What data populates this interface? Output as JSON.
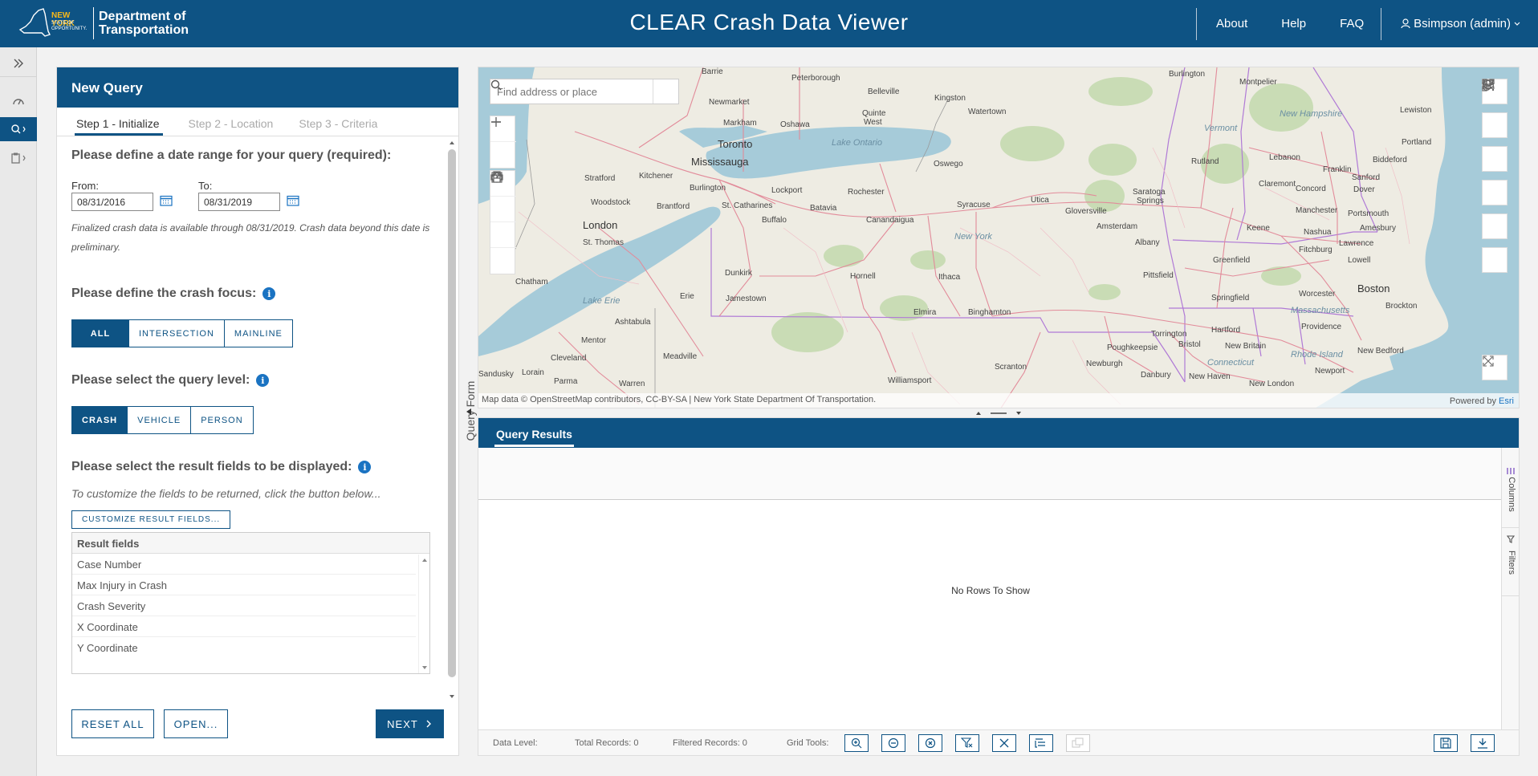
{
  "header": {
    "logo_state": "NEW YORK",
    "logo_tagline": "STATE OF OPPORTUNITY.",
    "logo_dept_line1": "Department of",
    "logo_dept_line2": "Transportation",
    "app_title": "CLEAR Crash Data Viewer",
    "nav": {
      "about": "About",
      "help": "Help",
      "faq": "FAQ",
      "user": "Bsimpson (admin)"
    }
  },
  "rail": {
    "items": [
      "expand-icon",
      "dashboard-icon",
      "search-icon",
      "clipboard-icon"
    ]
  },
  "query": {
    "title": "New Query",
    "steps": [
      "Step 1 - Initialize",
      "Step 2 - Location",
      "Step 3 - Criteria"
    ],
    "date_section": "Please define a date range for your query (required):",
    "from_label": "From:",
    "from_value": "08/31/2016",
    "to_label": "To:",
    "to_value": "08/31/2019",
    "note": "Finalized crash data is available through 08/31/2019. Crash data beyond this date is preliminary.",
    "focus_section": "Please define the crash focus:",
    "focus_options": [
      "ALL",
      "INTERSECTION",
      "MAINLINE"
    ],
    "level_section": "Please select the query level:",
    "level_options": [
      "CRASH",
      "VEHICLE",
      "PERSON"
    ],
    "fields_section": "Please select the result fields to be displayed:",
    "fields_hint": "To customize the fields to be returned, click the button below...",
    "customize_btn": "CUSTOMIZE RESULT FIELDS...",
    "fields_header": "Result fields",
    "fields": [
      "Case Number",
      "Max Injury in Crash",
      "Crash Severity",
      "X Coordinate",
      "Y Coordinate"
    ],
    "reset_btn": "RESET ALL",
    "open_btn": "OPEN...",
    "next_btn": "NEXT",
    "collapse_label": "Query Form"
  },
  "map": {
    "search_placeholder": "Find address or place",
    "attribution": "Map data © OpenStreetMap contributors, CC-BY-SA | New York State Department Of Transportation.",
    "powered_prefix": "Powered by ",
    "powered_brand": "Esri",
    "lakes": {
      "ontario": "Lake Ontario",
      "erie": "Lake Erie"
    },
    "regions": {
      "vermont": "Vermont",
      "nh": "New Hampshire",
      "ny": "New York",
      "mass": "Massachusetts",
      "ri": "Rhode Island",
      "ct": "Connecticut"
    },
    "cities": {
      "barrie": "Barrie",
      "peterborough": "Peterborough",
      "belleville": "Belleville",
      "kingston": "Kingston",
      "burlington_vt": "Burlington",
      "montpelier": "Montpelier",
      "lewiston": "Lewiston",
      "newmarket": "Newmarket",
      "markham": "Markham",
      "oshawa": "Oshawa",
      "quinte": "Quinte",
      "west": "West",
      "watertown": "Watertown",
      "portland": "Portland",
      "toronto": "Toronto",
      "mississauga": "Mississauga",
      "stratford": "Stratford",
      "kitchener": "Kitchener",
      "burlington_on": "Burlington",
      "oswego": "Oswego",
      "rutland": "Rutland",
      "lebanon": "Lebanon",
      "biddeford": "Biddeford",
      "franklin": "Franklin",
      "claremont": "Claremont",
      "sanford": "Sanford",
      "saratoga": "Saratoga",
      "springs": "Springs",
      "concord": "Concord",
      "dover": "Dover",
      "lockport": "Lockport",
      "rochester": "Rochester",
      "woodstock": "Woodstock",
      "brantford": "Brantford",
      "stcath": "St. Catharines",
      "batavia": "Batavia",
      "syracuse": "Syracuse",
      "utica": "Utica",
      "gloversville": "Gloversville",
      "manchester": "Manchester",
      "portsmouth": "Portsmouth",
      "london": "London",
      "buffalo": "Buffalo",
      "canandaigua": "Canandaigua",
      "amsterdam": "Amsterdam",
      "nashua": "Nashua",
      "amesbury": "Amesbury",
      "stthomas": "St. Thomas",
      "albany": "Albany",
      "keene": "Keene",
      "lawrence": "Lawrence",
      "fitchburg": "Fitchburg",
      "greenfield": "Greenfield",
      "lowell": "Lowell",
      "chatham": "Chatham",
      "dunkirk": "Dunkirk",
      "hornell": "Hornell",
      "ithaca": "Ithaca",
      "pittsfield": "Pittsfield",
      "boston": "Boston",
      "erie": "Erie",
      "jamestown": "Jamestown",
      "springfield": "Springfield",
      "worcester": "Worcester",
      "elmira": "Elmira",
      "binghamton": "Binghamton",
      "brockton": "Brockton",
      "ashtabula": "Ashtabula",
      "torrington": "Torrington",
      "hartford": "Hartford",
      "providence": "Providence",
      "mentor": "Mentor",
      "bristol": "Bristol",
      "newbritain": "New Britain",
      "poughkeepsie": "Poughkeepsie",
      "meadville": "Meadville",
      "cleveland": "Cleveland",
      "newburgh": "Newburgh",
      "newbedford": "New Bedford",
      "scranton": "Scranton",
      "sandusky": "Sandusky",
      "lorain": "Lorain",
      "danbury": "Danbury",
      "newhaven": "New Haven",
      "newport": "Newport",
      "parma": "Parma",
      "warren": "Warren",
      "williamsport": "Williamsport",
      "newlondon": "New London"
    }
  },
  "results": {
    "tab": "Query Results",
    "empty": "No Rows To Show",
    "side_tabs": [
      "Columns",
      "Filters"
    ],
    "data_level": "Data Level:",
    "total": "Total Records: 0",
    "filtered": "Filtered Records: 0",
    "grid_tools": "Grid Tools:"
  }
}
